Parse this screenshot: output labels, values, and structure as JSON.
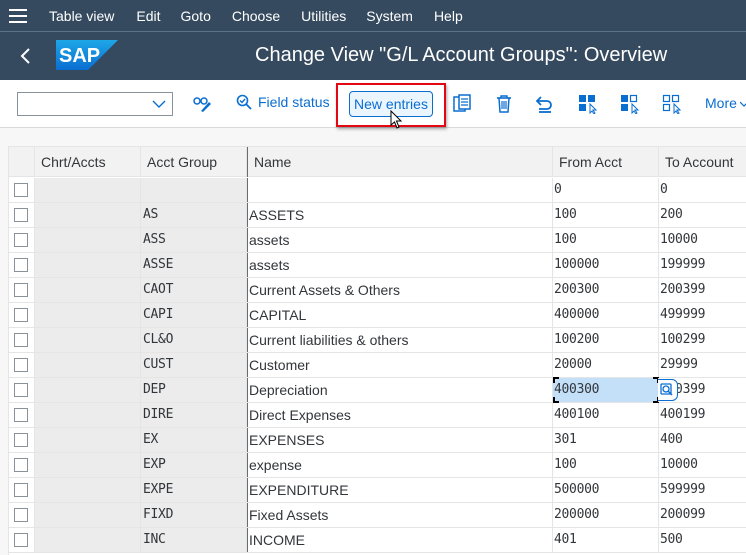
{
  "menubar": {
    "items": [
      "Table view",
      "Edit",
      "Goto",
      "Choose",
      "Utilities",
      "System",
      "Help"
    ]
  },
  "titlebar": {
    "logo": "SAP",
    "title": "Change View \"G/L Account Groups\": Overview"
  },
  "toolbar": {
    "dropdown_value": "",
    "field_status_label": "Field status",
    "new_entries_label": "New entries",
    "more_label": "More",
    "icons": [
      "display-change-icon",
      "field-status-icon",
      "copy-icon",
      "delete-icon",
      "undo-icon",
      "select-all-icon",
      "select-block-icon",
      "deselect-all-icon",
      "chevron-down-icon"
    ]
  },
  "colors": {
    "shell": "#354a5f",
    "accent": "#0a6ed1",
    "highlight_box": "#e30613",
    "selected_cell": "#c4e0f8"
  },
  "table": {
    "columns": [
      "Chrt/Accts",
      "Acct Group",
      "Name",
      "From Acct",
      "To Account"
    ],
    "rows": [
      {
        "chart": "",
        "group": "",
        "name": "",
        "from": "0",
        "to": "0"
      },
      {
        "chart": "",
        "group": "AS",
        "name": "ASSETS",
        "from": "100",
        "to": "200"
      },
      {
        "chart": "",
        "group": "ASS",
        "name": "assets",
        "from": "100",
        "to": "10000"
      },
      {
        "chart": "",
        "group": "ASSE",
        "name": "assets",
        "from": "100000",
        "to": "199999"
      },
      {
        "chart": "",
        "group": "CAOT",
        "name": "Current Assets & Others",
        "from": "200300",
        "to": "200399"
      },
      {
        "chart": "",
        "group": "CAPI",
        "name": "CAPITAL",
        "from": "400000",
        "to": "499999"
      },
      {
        "chart": "",
        "group": "CL&O",
        "name": "Current liabilities & others",
        "from": "100200",
        "to": "100299"
      },
      {
        "chart": "",
        "group": "CUST",
        "name": "Customer",
        "from": "20000",
        "to": "29999"
      },
      {
        "chart": "",
        "group": "DEP",
        "name": "Depreciation",
        "from": "400300",
        "to": "400399"
      },
      {
        "chart": "",
        "group": "DIRE",
        "name": "Direct Expenses",
        "from": "400100",
        "to": "400199"
      },
      {
        "chart": "",
        "group": "EX",
        "name": "EXPENSES",
        "from": "301",
        "to": "400"
      },
      {
        "chart": "",
        "group": "EXP",
        "name": "expense",
        "from": "100",
        "to": "10000"
      },
      {
        "chart": "",
        "group": "EXPE",
        "name": "EXPENDITURE",
        "from": "500000",
        "to": "599999"
      },
      {
        "chart": "",
        "group": "FIXD",
        "name": "Fixed Assets",
        "from": "200000",
        "to": "200099"
      },
      {
        "chart": "",
        "group": "INC",
        "name": "INCOME",
        "from": "401",
        "to": "500"
      }
    ],
    "selected_row": 8,
    "selected_column": "from"
  }
}
